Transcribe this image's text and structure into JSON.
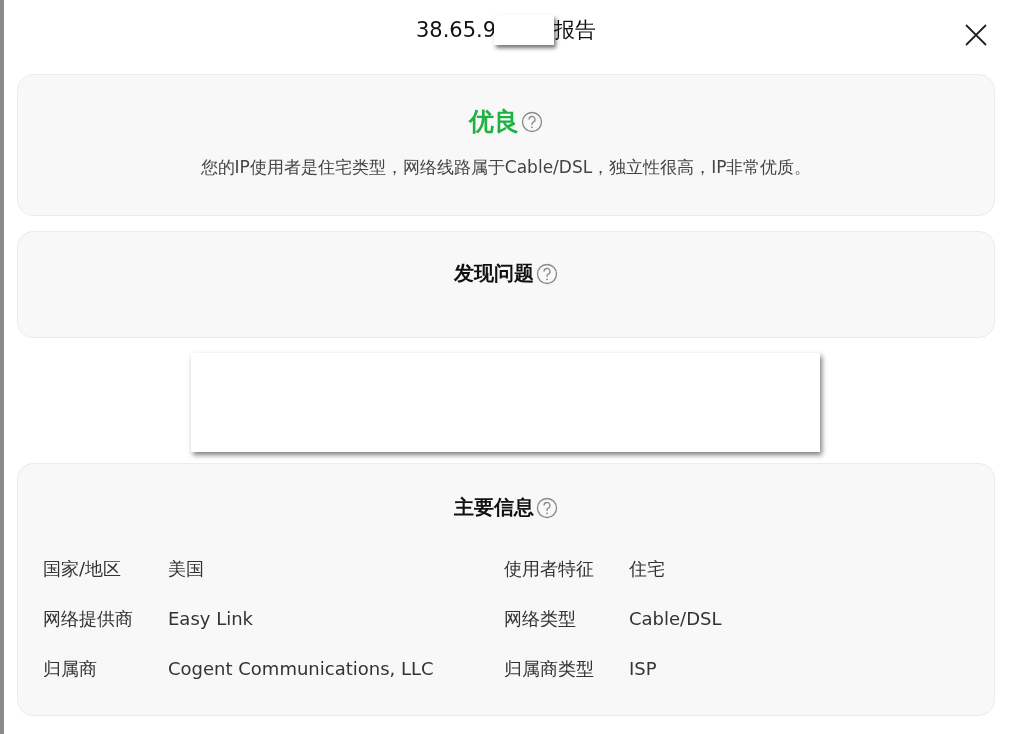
{
  "title": {
    "start": "38.65.9",
    "end": "报告",
    "redacted": true
  },
  "summary": {
    "grade": "优良",
    "color": "#1fb141",
    "text": "您的IP使用者是住宅类型，网络线路属于Cable/DSL，独立性很高，IP非常优质。"
  },
  "problems": {
    "heading": "发现问题"
  },
  "redacted_block": true,
  "main_info": {
    "heading": "主要信息",
    "fields": [
      {
        "label": "国家/地区",
        "value": "美国"
      },
      {
        "label": "使用者特征",
        "value": "住宅"
      },
      {
        "label": "网络提供商",
        "value": "Easy Link"
      },
      {
        "label": "网络类型",
        "value": "Cable/DSL"
      },
      {
        "label": "归属商",
        "value": "Cogent Communications, LLC"
      },
      {
        "label": "归属商类型",
        "value": "ISP"
      }
    ]
  }
}
